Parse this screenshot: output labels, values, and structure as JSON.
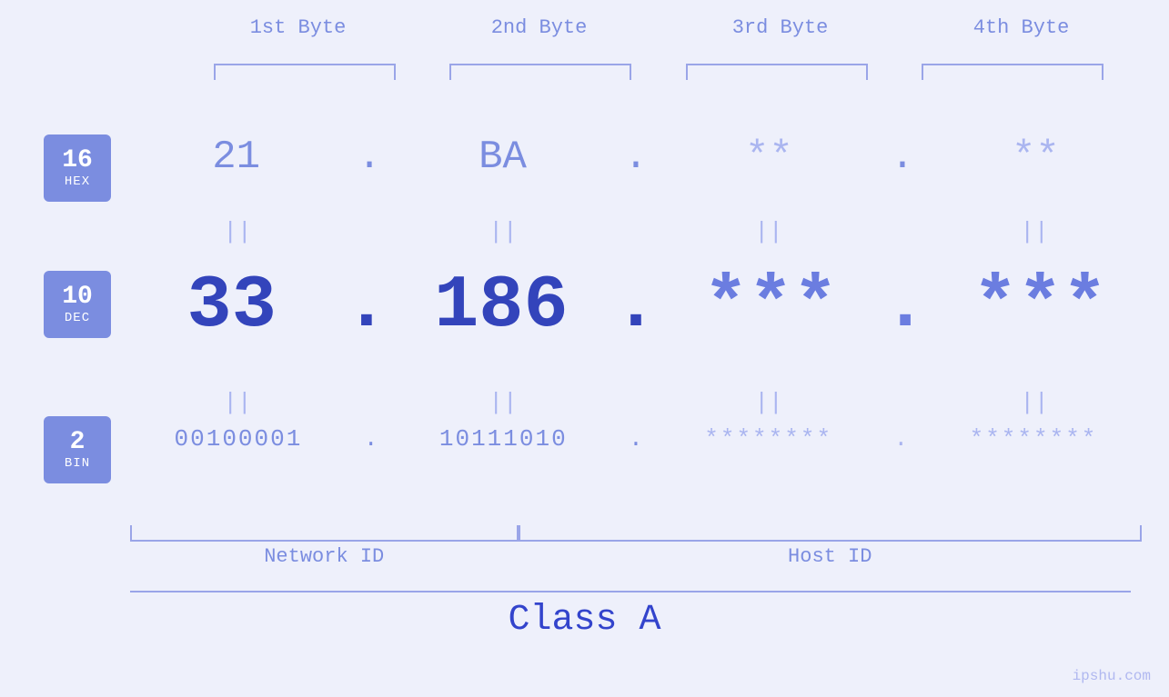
{
  "bytes": {
    "headers": [
      "1st Byte",
      "2nd Byte",
      "3rd Byte",
      "4th Byte"
    ]
  },
  "badges": {
    "hex": {
      "number": "16",
      "label": "HEX"
    },
    "dec": {
      "number": "10",
      "label": "DEC"
    },
    "bin": {
      "number": "2",
      "label": "BIN"
    }
  },
  "rows": {
    "hex": {
      "values": [
        "21",
        "BA",
        "**",
        "**"
      ],
      "dots": [
        ".",
        ".",
        "."
      ]
    },
    "dec": {
      "values": [
        "33",
        "186",
        "***",
        "***"
      ],
      "dots": [
        ".",
        ".",
        "."
      ]
    },
    "bin": {
      "values": [
        "00100001",
        "10111010",
        "********",
        "********"
      ],
      "dots": [
        ".",
        ".",
        "."
      ]
    }
  },
  "labels": {
    "network_id": "Network ID",
    "host_id": "Host ID",
    "class": "Class A"
  },
  "watermark": "ipshu.com"
}
